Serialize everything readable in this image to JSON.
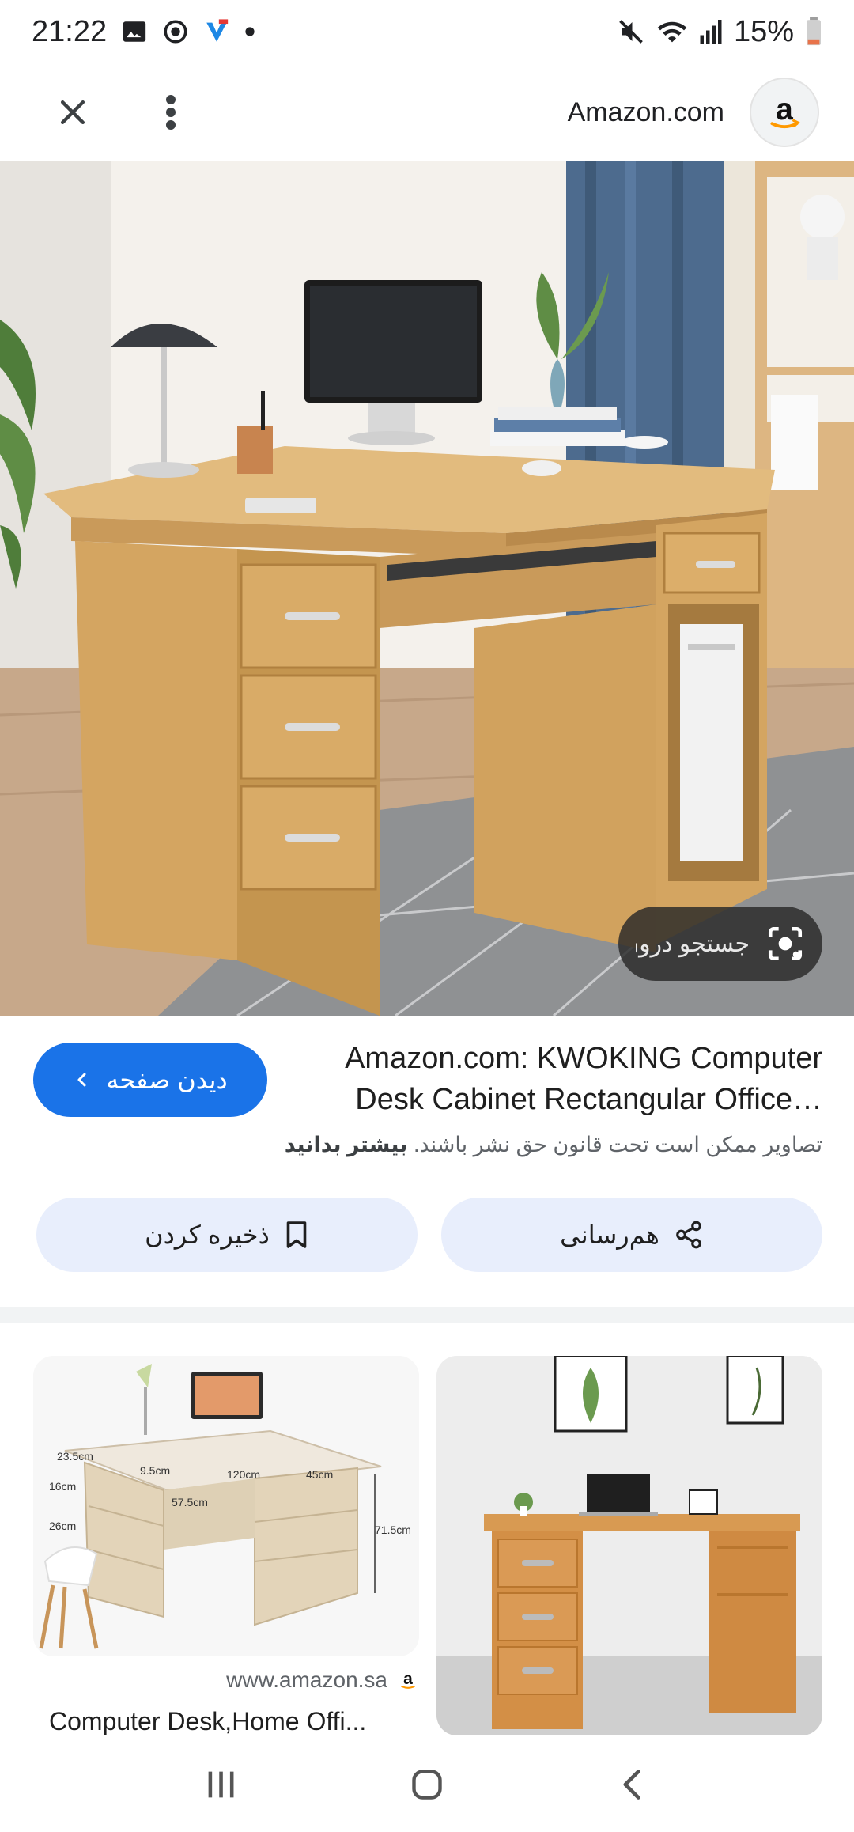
{
  "status_bar": {
    "time": "21:22",
    "battery": "15%",
    "icons": [
      "gallery-icon",
      "sync-icon",
      "vpn-icon",
      "dot-icon",
      "mute-icon",
      "wifi-icon",
      "signal-icon",
      "battery-icon"
    ]
  },
  "top_bar": {
    "source_name": "Amazon.com",
    "logo_letter": "a",
    "icons": [
      "close-icon",
      "more-vert-icon"
    ]
  },
  "hero": {
    "lens_label": "جستجو درون تصویر"
  },
  "info": {
    "title_line1": "Amazon.com: KWOKING Computer",
    "title_line2": "Desk Cabinet Rectangular Office…",
    "view_button": "دیدن صفحه",
    "copyright_text": "تصاویر ممکن است تحت قانون حق نشر باشند.",
    "learn_more": "بیشتر بدانید"
  },
  "actions": {
    "save": "ذخیره کردن",
    "share": "هم‌رسانی"
  },
  "results": [
    {
      "source": "www.amazon.sa",
      "title": "Computer Desk,Home Offi...",
      "dimensions": [
        "23.5cm",
        "9.5cm",
        "120cm",
        "45cm",
        "16cm",
        "57.5cm",
        "26cm",
        "71.5cm"
      ]
    },
    {
      "source": "",
      "title": ""
    }
  ],
  "nav_bar": {
    "icons": [
      "recent-apps-icon",
      "home-icon",
      "back-icon"
    ]
  },
  "colors": {
    "accent": "#1a73e8",
    "tonal_button": "#e8eefc",
    "wood": "#d9a866"
  }
}
